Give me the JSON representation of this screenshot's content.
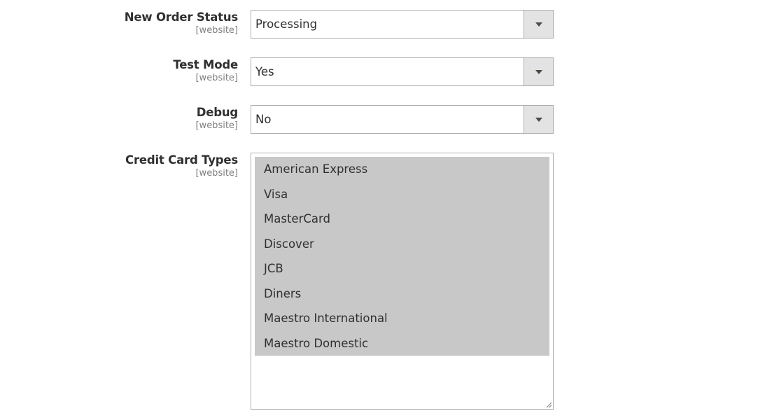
{
  "fields": {
    "new_order_status": {
      "label": "New Order Status",
      "scope": "[website]",
      "value": "Processing"
    },
    "test_mode": {
      "label": "Test Mode",
      "scope": "[website]",
      "value": "Yes"
    },
    "debug": {
      "label": "Debug",
      "scope": "[website]",
      "value": "No"
    },
    "credit_card_types": {
      "label": "Credit Card Types",
      "scope": "[website]",
      "options": [
        "American Express",
        "Visa",
        "MasterCard",
        "Discover",
        "JCB",
        "Diners",
        "Maestro International",
        "Maestro Domestic"
      ]
    }
  },
  "icons": {
    "dropdown": "chevron-down-icon",
    "resize": "resize-handle-icon"
  },
  "colors": {
    "label": "#303030",
    "scope": "#808080",
    "border": "#adadad",
    "dropdown_button_bg": "#e3e3e3",
    "selected_option_bg": "#c8c8c8"
  }
}
